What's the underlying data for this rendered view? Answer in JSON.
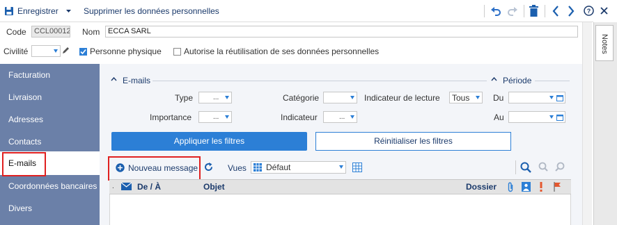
{
  "toolbar": {
    "save_label": "Enregistrer",
    "delete_personal_label": "Supprimer les données personnelles"
  },
  "header": {
    "code_label": "Code",
    "code_value": "CCL00012",
    "nom_label": "Nom",
    "nom_value": "ECCA SARL",
    "civilite_label": "Civilité",
    "personne_physique_label": "Personne physique",
    "personne_physique_checked": true,
    "reuse_label": "Autorise la réutilisation de ses données personnelles",
    "reuse_checked": false
  },
  "notes": {
    "label": "Notes"
  },
  "sidebar": {
    "items": [
      {
        "label": "Facturation"
      },
      {
        "label": "Livraison"
      },
      {
        "label": "Adresses"
      },
      {
        "label": "Contacts"
      },
      {
        "label": "E-mails"
      },
      {
        "label": "Coordonnées bancaires"
      },
      {
        "label": "Divers"
      }
    ],
    "active_index": 4
  },
  "filters": {
    "emails_title": "E-mails",
    "periode_title": "Période",
    "type_label": "Type",
    "type_value": "...",
    "categorie_label": "Catégorie",
    "categorie_value": "",
    "indicateur_lecture_label": "Indicateur de lecture",
    "indicateur_lecture_value": "Tous",
    "importance_label": "Importance",
    "importance_value": "...",
    "indicateur_label": "Indicateur",
    "indicateur_value": "...",
    "du_label": "Du",
    "au_label": "Au",
    "apply_label": "Appliquer les filtres",
    "reset_label": "Réinitialiser les filtres"
  },
  "grid_toolbar": {
    "new_message_label": "Nouveau message",
    "vues_label": "Vues",
    "vues_value": "Défaut"
  },
  "grid": {
    "columns": [
      "De / À",
      "Objet",
      "Dossier"
    ],
    "first_col_marker": "."
  },
  "colors": {
    "accent": "#2c7fd6",
    "sidebar": "#6b80a8",
    "highlight": "#e02020"
  }
}
